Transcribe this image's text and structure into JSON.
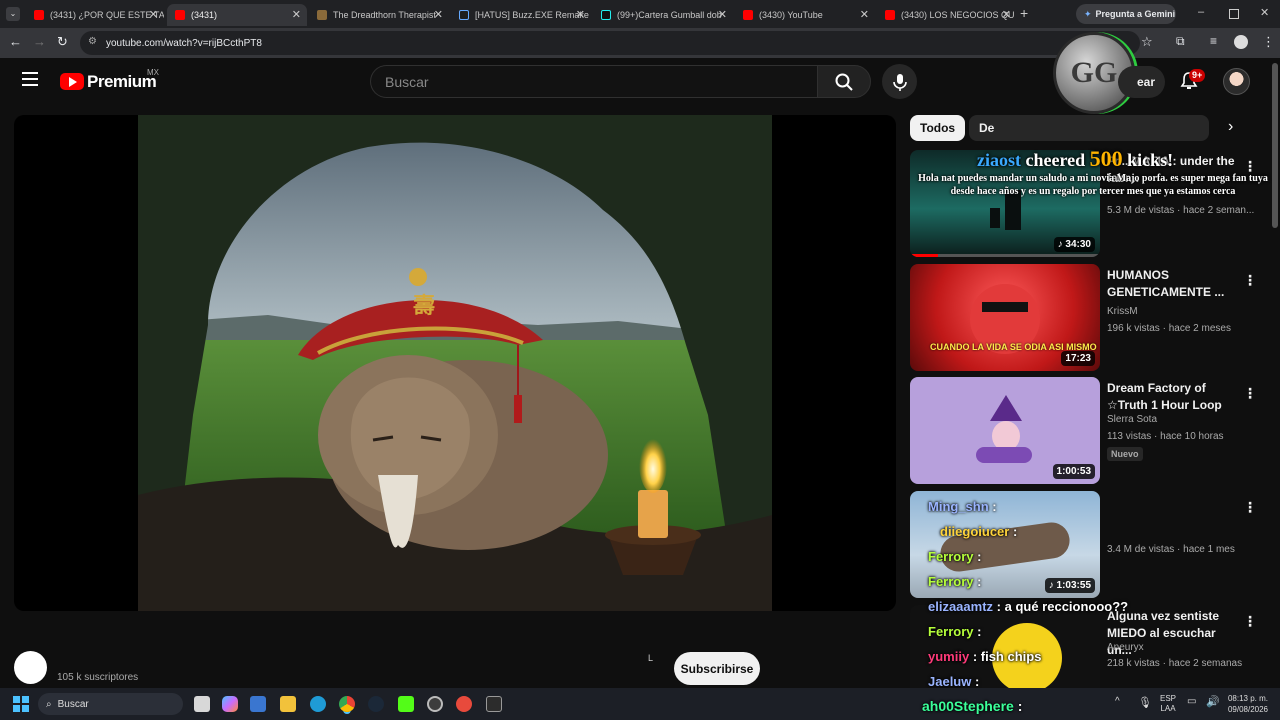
{
  "browser": {
    "tabs": [
      {
        "title": "(3431) ¿POR QUE ESTE TA",
        "fav_color": "#ff0000"
      },
      {
        "title": "(3431)",
        "fav_color": "#ff0000"
      },
      {
        "title": "The Dreadthorn Therapist",
        "fav_color": "#8a6a3a"
      },
      {
        "title": "[HATUS] Buzz.EXE Remake",
        "fav_color": "#1e1e1e"
      },
      {
        "title": "(99+)Cartera Gumball dob",
        "fav_color": "#111111"
      },
      {
        "title": "(3430) YouTube",
        "fav_color": "#ff0000"
      },
      {
        "title": "(3430) LOS NEGOCIOS QU",
        "fav_color": "#ff0000"
      }
    ],
    "new_tab": "+",
    "gemini_label": "Pregunta a Gemini",
    "url": "youtube.com/watch?v=rijBCcthPT8"
  },
  "youtube": {
    "logo_text": "Premium",
    "region": "MX",
    "search_placeholder": "Buscar",
    "create_label": "ear",
    "notif_count": "9+",
    "chips": [
      "Todos",
      "De"
    ],
    "subscribers": "105 k suscriptores",
    "subscribe_label": "Subscribirse",
    "player_char": "L"
  },
  "recommendations": [
    {
      "title": "Fr... MAFIA : under the fabr...",
      "channel": "",
      "views": "5.3 M de vistas · hace 2 seman...",
      "duration": "34:30",
      "music": true,
      "new": false
    },
    {
      "title": "HUMANOS GENETICAMENTE ...",
      "channel": "KrissM",
      "views": "196 k vistas · hace 2 meses",
      "duration": "17:23",
      "music": false,
      "new": false
    },
    {
      "title": "Dream Factory of ☆Truth 1 Hour Loop",
      "channel": "Slerra Sota",
      "views": "113 vistas · hace 10 horas",
      "duration": "1:00:53",
      "music": false,
      "new": true
    },
    {
      "title": "",
      "channel": "",
      "views": "3.4 M de vistas · hace 1 mes",
      "duration": "1:03:55",
      "music": true,
      "new": false
    },
    {
      "title": "Alguna vez sentiste MIEDO al escuchar un...",
      "channel": "Aneuryx",
      "views": "218 k vistas · hace 2 semanas",
      "duration": "",
      "music": false,
      "new": false
    }
  ],
  "thumbnail_text": {
    "card2": "CUANDO LA VIDA SE ODIA ASI MISMO"
  },
  "overlay": {
    "cheer_user": "ziaost",
    "cheer_text": "cheered",
    "cheer_amount": "500",
    "cheer_suffix": "kicks!",
    "cheer_message": "Hola nat puedes mandar un saludo a mi novia Majo porfa. es super mega fan tuya desde hace años y es un regalo por tercer mes que ya estamos cerca",
    "avatar_text": "GG",
    "chat": [
      {
        "user": "Ming_shn",
        "msg": ":",
        "color": "#9ab4ff"
      },
      {
        "user": "diiegoiucer",
        "msg": ":",
        "color": "#ffd43b"
      },
      {
        "user": "Ferrory",
        "msg": ":",
        "color": "#b6ff3b"
      },
      {
        "user": "Ferrory",
        "msg": ":",
        "color": "#b6ff3b"
      },
      {
        "user": "elizaaamtz",
        "msg": ": a qué reccionooo??",
        "color": "#9ab4ff"
      },
      {
        "user": "Ferrory",
        "msg": ":",
        "color": "#b6ff3b"
      },
      {
        "user": "yumiiy",
        "msg": ": fish chips",
        "color": "#ff3b7a"
      },
      {
        "user": "Jaeluw",
        "msg": ":",
        "color": "#9ab4ff"
      },
      {
        "user": "ah00Stephere",
        "msg": ":",
        "color": "#3bff9a"
      }
    ]
  },
  "taskbar": {
    "search_label": "Buscar",
    "lang": "ESP",
    "lang2": "LAA",
    "time": "08:13 p. m.",
    "date": "09/08/2026"
  },
  "colors": {
    "accent": "#ff0000",
    "bg": "#0f0f0f"
  }
}
